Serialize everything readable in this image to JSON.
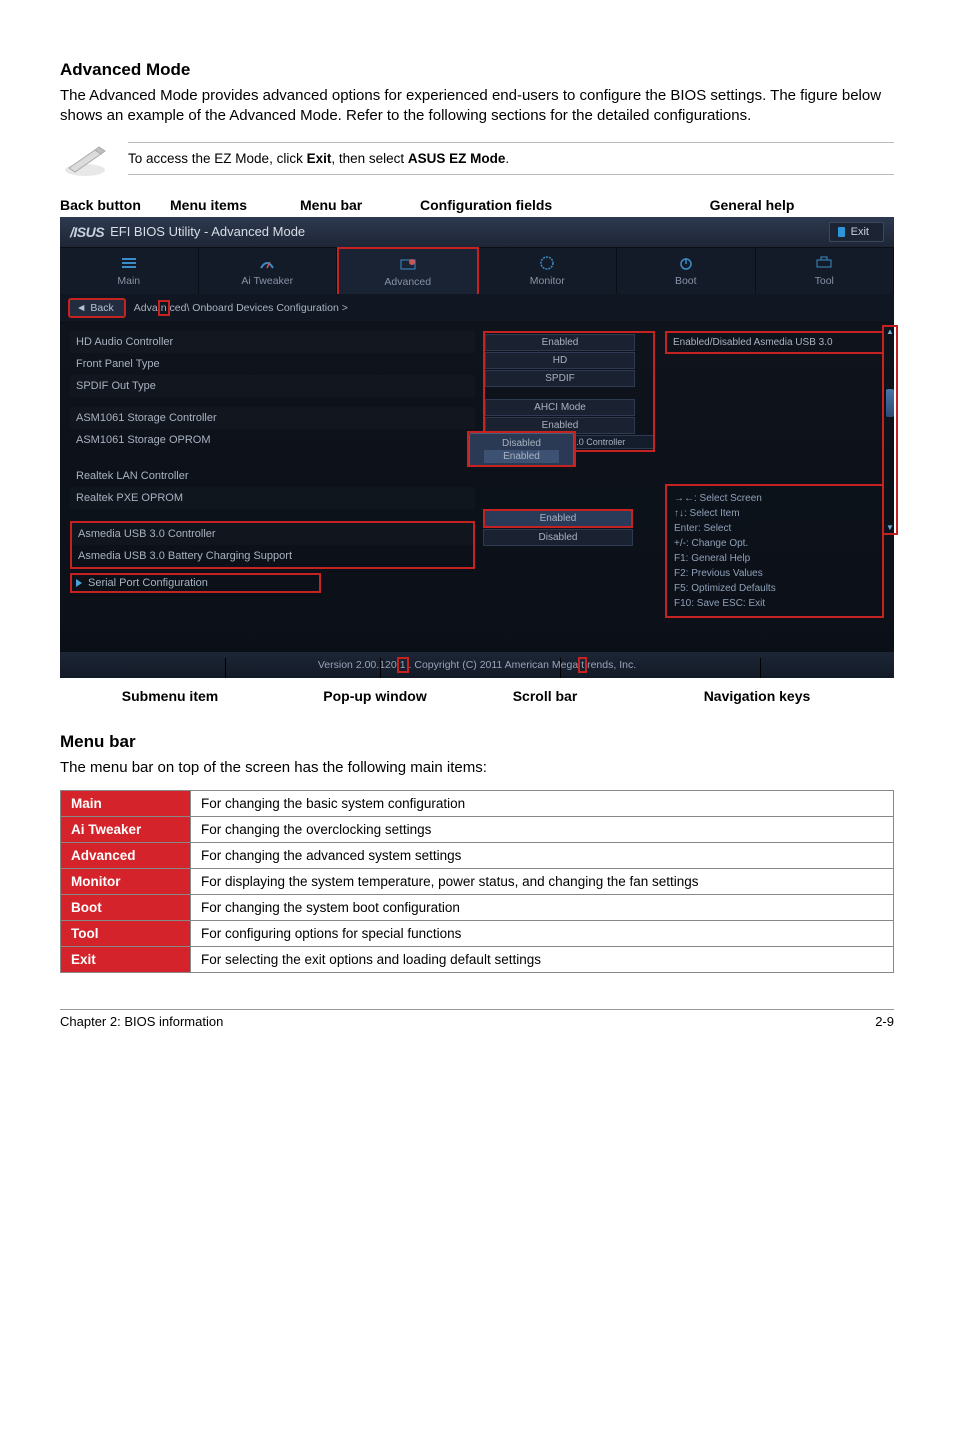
{
  "section1_title": "Advanced Mode",
  "section1_body": "The Advanced Mode provides advanced options for experienced end-users to configure the BIOS settings. The figure below shows an example of the Advanced Mode. Refer to the following sections for the detailed configurations.",
  "note_text_pre": "To access the EZ Mode, click ",
  "note_bold1": "Exit",
  "note_text_mid": ", then select ",
  "note_bold2": "ASUS EZ Mode",
  "note_text_post": ".",
  "labels": {
    "back": "Back button",
    "menuitems": "Menu items",
    "menubar": "Menu bar",
    "config": "Configuration fields",
    "help": "General help"
  },
  "bios": {
    "title": "EFI BIOS Utility - Advanced Mode",
    "exit": "Exit",
    "tabs": [
      "Main",
      "Ai  Tweaker",
      "Advanced",
      "Monitor",
      "Boot",
      "Tool"
    ],
    "back_label": "Back",
    "crumb_pre": "Adva",
    "crumb_hl": "n",
    "crumb_post": "ced\\ Onboard Devices Configuration  >",
    "rows": {
      "hd_audio": "HD Audio Controller",
      "front_panel": "Front Panel Type",
      "spdif": "SPDIF Out Type",
      "asm_ctrl": "ASM1061 Storage Controller",
      "asm_oprom": "ASM1061 Storage OPROM",
      "usb_subheader": "Asmedia USB 3.0 Controller",
      "realtek_lan": "Realtek LAN Controller",
      "realtek_pxe": "Realtek PXE OPROM",
      "usb30": "Asmedia USB 3.0 Controller",
      "usb30_batt": "Asmedia USB 3.0 Battery Charging Support",
      "serial": "Serial Port Configuration"
    },
    "vals": {
      "enabled": "Enabled",
      "hd": "HD",
      "spdif": "SPDIF",
      "ahci": "AHCI Mode",
      "enabled2": "Enabled",
      "popup_disabled": "Disabled",
      "popup_enabled": "Enabled",
      "usb_enabled": "Enabled",
      "usb_disabled": "Disabled"
    },
    "help_text": "Enabled/Disabled Asmedia USB 3.0",
    "nav_lines": [
      "→←:  Select Screen",
      "↑↓:  Select Item",
      "Enter:  Select",
      "+/-:   Change Opt.",
      "F1:  General Help",
      "F2:  Previous Values",
      "F5:  Optimized Defaults",
      "F10:  Save   ESC:  Exit"
    ],
    "footer_pre": "Version 2.00.120",
    "footer_hl": "1",
    "footer_post": ".   Copyright (C) 2011 American Mega",
    "footer_hl2": "t",
    "footer_post2": "rends, Inc."
  },
  "bottom_labels": {
    "submenu": "Submenu item",
    "popup": "Pop-up window",
    "scroll": "Scroll bar",
    "nav": "Navigation keys"
  },
  "section2_title": "Menu bar",
  "section2_body": "The menu bar on top of the screen has the following main items:",
  "table": [
    {
      "k": "Main",
      "v": "For changing the basic system configuration"
    },
    {
      "k": "Ai Tweaker",
      "v": "For changing the overclocking settings"
    },
    {
      "k": "Advanced",
      "v": "For changing the advanced system settings"
    },
    {
      "k": "Monitor",
      "v": "For displaying the system temperature, power status, and changing the fan settings"
    },
    {
      "k": "Boot",
      "v": "For changing the system boot configuration"
    },
    {
      "k": "Tool",
      "v": "For configuring options for special functions"
    },
    {
      "k": "Exit",
      "v": "For selecting the exit options and loading default settings"
    }
  ],
  "footer_left": "Chapter 2: BIOS information",
  "footer_right": "2-9"
}
